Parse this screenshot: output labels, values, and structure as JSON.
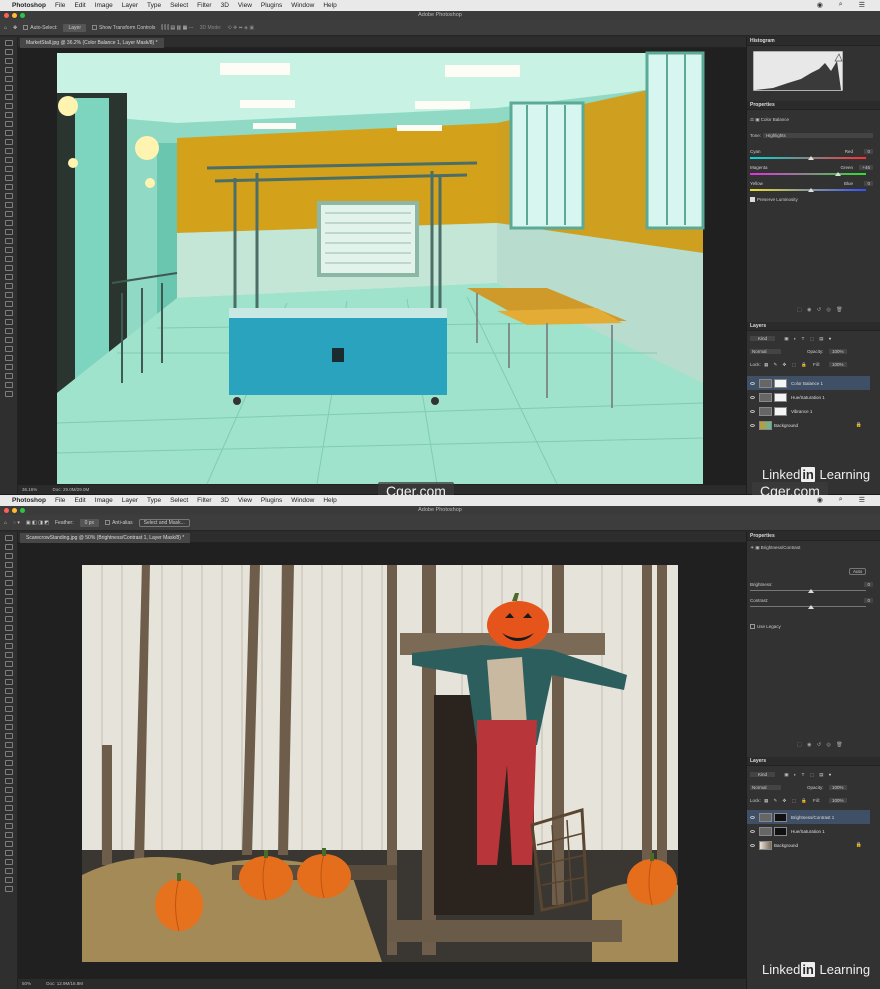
{
  "menu": {
    "apple": "",
    "app": "Photoshop",
    "items": [
      "File",
      "Edit",
      "Image",
      "Layer",
      "Type",
      "Select",
      "Filter",
      "3D",
      "View",
      "Plugins",
      "Window",
      "Help"
    ]
  },
  "window_title": "Adobe Photoshop",
  "top": {
    "options": {
      "auto_select": "Auto-Select:",
      "target": "Layer",
      "transform": "Show Transform Controls",
      "mode3d": "3D Mode:"
    },
    "doc_tab": "MarketStall.jpg @ 36.2% (Color Balance 1, Layer Mask/8) *",
    "status": {
      "zoom": "36.16%",
      "doc": "Doc: 29.0M/29.0M"
    },
    "histogram": {
      "title": "Histogram"
    },
    "properties": {
      "title": "Properties",
      "adjustment": "Color Balance",
      "tone_label": "Tone:",
      "tone_value": "Highlights",
      "sliders": [
        {
          "left": "Cyan",
          "right": "Red",
          "value": "0",
          "position": 0.5
        },
        {
          "left": "Magenta",
          "right": "Green",
          "value": "+46",
          "position": 0.73
        },
        {
          "left": "Yellow",
          "right": "Blue",
          "value": "0",
          "position": 0.5
        }
      ],
      "preserve": "Preserve Luminosity"
    },
    "layers": {
      "title": "Layers",
      "kind": "Kind",
      "blend": "Normal",
      "opacity_label": "Opacity:",
      "opacity": "100%",
      "lock_label": "Lock:",
      "fill_label": "Fill:",
      "fill": "100%",
      "rows": [
        "Color Balance 1",
        "Hue/Saturation 1",
        "Vibrance 1",
        "Background"
      ]
    }
  },
  "bottom": {
    "options": {
      "feather_label": "Feather:",
      "feather": "0 px",
      "antialias": "Anti-alias",
      "select_mask": "Select and Mask..."
    },
    "doc_tab": "ScarecrowStanding.jpg @ 50% (Brightness/Contrast 1, Layer Mask/8) *",
    "status": {
      "zoom": "50%",
      "doc": "Doc: 12.9M/16.8M"
    },
    "properties": {
      "title": "Properties",
      "adjustment": "Brightness/Contrast",
      "auto": "Auto",
      "sliders": [
        {
          "label": "Brightness:",
          "value": "0",
          "position": 0.5
        },
        {
          "label": "Contrast:",
          "value": "0",
          "position": 0.5
        }
      ],
      "legacy": "Use Legacy"
    },
    "layers": {
      "title": "Layers",
      "kind": "Kind",
      "blend": "Normal",
      "opacity_label": "Opacity:",
      "opacity": "100%",
      "lock_label": "Lock:",
      "fill_label": "Fill:",
      "fill": "100%",
      "rows": [
        "Brightness/Contrast 1",
        "Hue/Saturation 1",
        "Background"
      ]
    }
  },
  "watermarks": {
    "cger": "Cger.com",
    "linked_pre": "Linked",
    "linked_in": "in",
    "linked_post": " Learning"
  }
}
